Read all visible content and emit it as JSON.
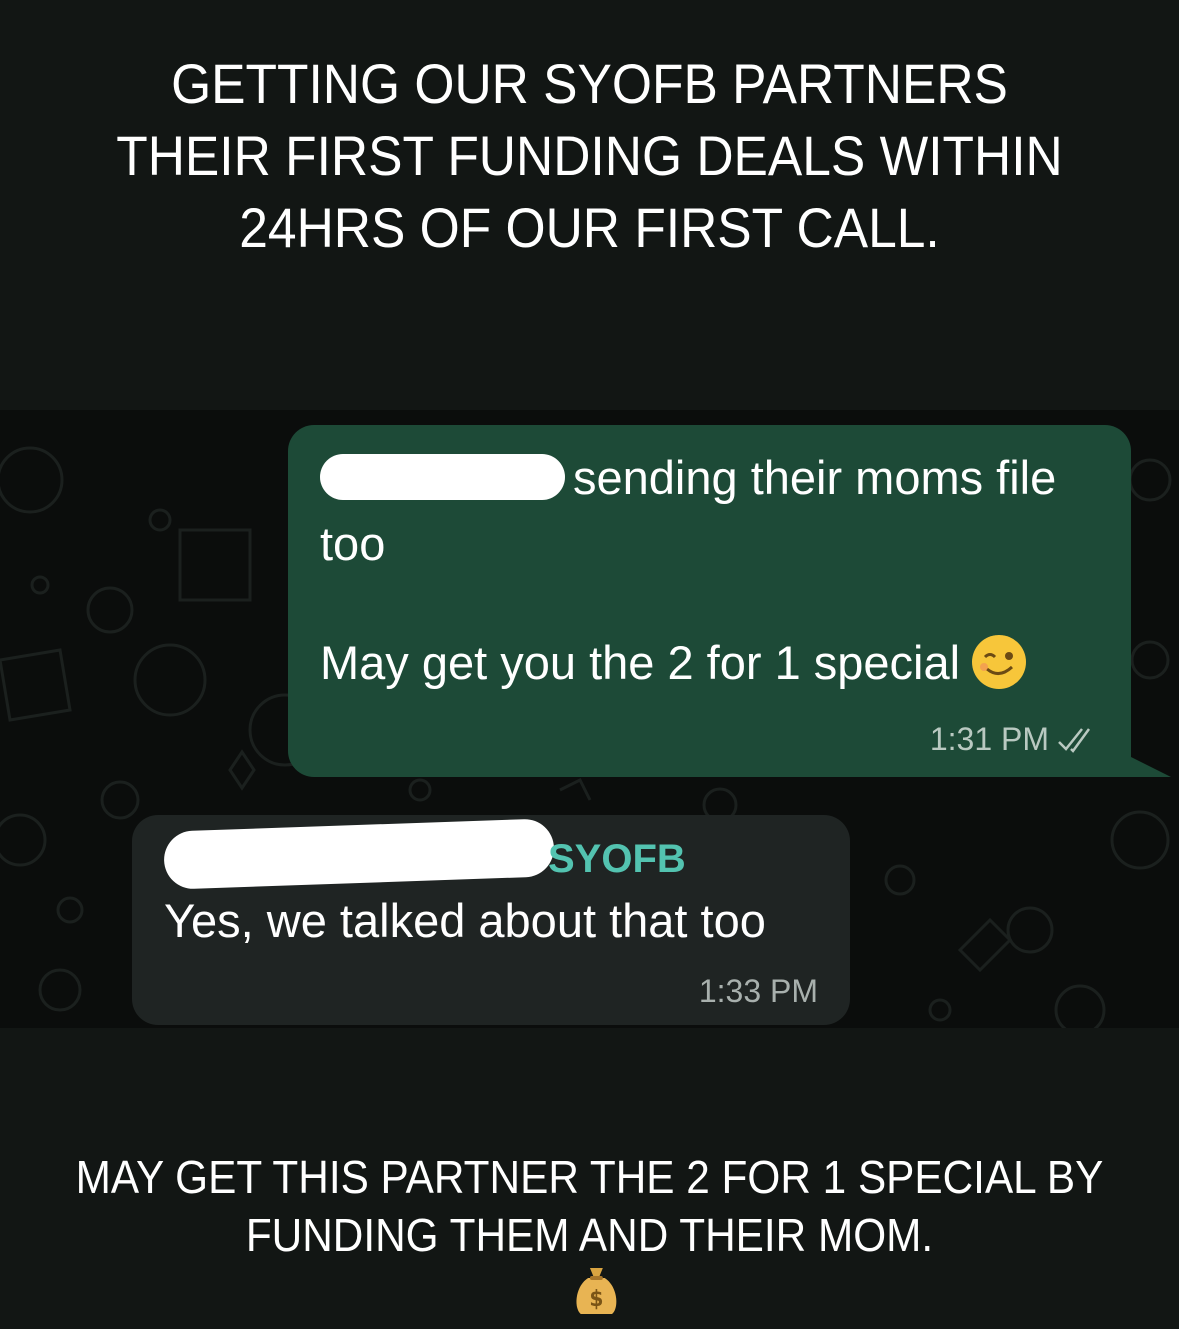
{
  "headline": {
    "lines": [
      "GETTING OUR SYOFB PARTNERS",
      "THEIR FIRST FUNDING DEALS WITHIN",
      "24HRS OF OUR FIRST CALL."
    ]
  },
  "chat": {
    "outgoing": {
      "line1": "sending their moms file too",
      "line2": "May get you the 2 for 1 special",
      "emoji": "winking-face",
      "time": "1:31 PM",
      "status": "read-double-check"
    },
    "incoming": {
      "sender": "SYOFB",
      "text": "Yes, we talked about that too",
      "time": "1:33 PM"
    }
  },
  "caption": {
    "lines": [
      "MAY GET THIS PARTNER THE 2 FOR 1 SPECIAL BY",
      "FUNDING THEM AND THEIR MOM."
    ],
    "emoji": "money-bag"
  },
  "colors": {
    "background": "#121614",
    "outgoing_bubble": "#1d4a37",
    "incoming_bubble": "#1f2423",
    "sender_name": "#53c3b0"
  }
}
